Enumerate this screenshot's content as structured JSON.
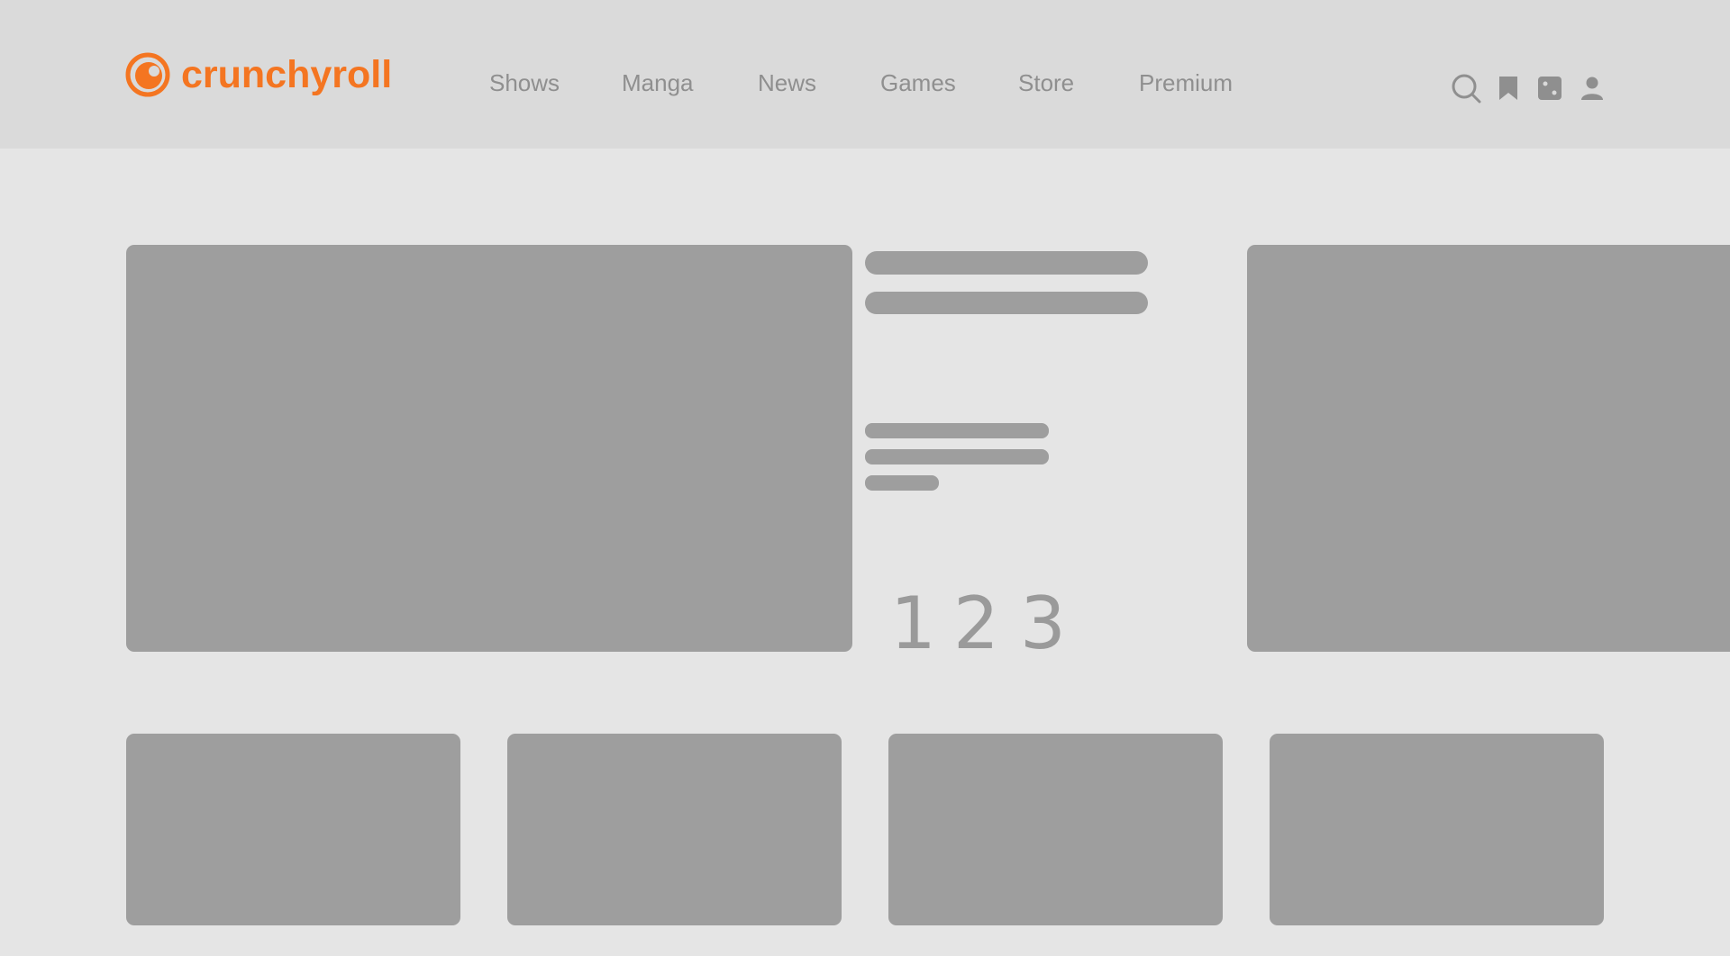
{
  "brand": {
    "name": "crunchyroll",
    "color": "#f47521"
  },
  "nav": {
    "items": [
      {
        "label": "Shows"
      },
      {
        "label": "Manga"
      },
      {
        "label": "News"
      },
      {
        "label": "Games"
      },
      {
        "label": "Store"
      },
      {
        "label": "Premium"
      }
    ]
  },
  "header_icons": [
    "search-icon",
    "bookmark-icon",
    "random-dice-icon",
    "user-icon"
  ],
  "carousel": {
    "pages": [
      "1",
      "2",
      "3"
    ]
  },
  "colors": {
    "header_bg": "#dadada",
    "page_bg": "#e5e5e5",
    "placeholder": "#9e9e9e",
    "nav_text": "#8f8f8f"
  }
}
